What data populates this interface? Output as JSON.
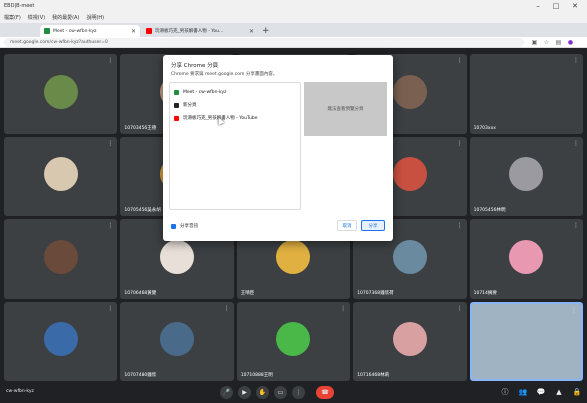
{
  "window": {
    "title": "EBD|B-meet",
    "menu": [
      "檔案(F)",
      "檢視(V)",
      "我的最愛(A)",
      "說明(H)"
    ]
  },
  "browser": {
    "tabs": [
      {
        "label": "Meet - cw-wfbn-kyz",
        "fav_color": "#1e8e3e"
      },
      {
        "label": "玩滑板巧克_男孩解書人物 - You…",
        "fav_color": "#ff0000"
      }
    ],
    "url": "meet.google.com/cw-wfbn-kyz?authuser=0"
  },
  "dialog": {
    "title": "分享 Chrome 分頁",
    "subtitle": "Chrome 要求與 meet.google.com 分享畫面內容。",
    "sources": [
      {
        "label": "Meet - cw-wfbn-kyz",
        "icon_color": "#1e8e3e"
      },
      {
        "label": "新分頁",
        "icon_color": "#202124"
      },
      {
        "label": "玩滑板巧克_男孩解書人物 - YouTube",
        "icon_color": "#ff0000"
      }
    ],
    "preview_text": "無法查看預覽分頁",
    "share_audio_label": "分享音訊",
    "cancel_label": "取消",
    "share_label": "分享"
  },
  "participants": [
    {
      "name": "",
      "color": "#6a8a4a"
    },
    {
      "name": "10703456王德",
      "color": "#c8a088"
    },
    {
      "name": "",
      "color": "#5a7a9a"
    },
    {
      "name": "",
      "color": "#7a6050"
    },
    {
      "name": "10703xxx",
      "color": "#3c4043"
    },
    {
      "name": "",
      "color": "#d8c8b0"
    },
    {
      "name": "10705456吳永胡",
      "color": "#d8a040"
    },
    {
      "name": "",
      "color": "#8a9a6a"
    },
    {
      "name": "10706528揚源",
      "color": "#c85040"
    },
    {
      "name": "10705456林明",
      "color": "#9a9aa0"
    },
    {
      "name": "",
      "color": "#6a4a3a"
    },
    {
      "name": "10706468黃健",
      "color": "#e8e0d8"
    },
    {
      "name": "王晴臣",
      "color": "#e0b040"
    },
    {
      "name": "10707368鐘欣荷",
      "color": "#6a8aa0"
    },
    {
      "name": "10714摘要",
      "color": "#e898b0"
    },
    {
      "name": "",
      "color": "#3a6aa8"
    },
    {
      "name": "10707480鐘欣",
      "color": "#4a6a8a"
    },
    {
      "name": "10710888王明",
      "color": "#4ab848"
    },
    {
      "name": "10716468林莉",
      "color": "#d8a0a0"
    },
    {
      "name": "",
      "color": "#9fb3c2"
    }
  ],
  "bottom": {
    "meeting_code": "cw-wfbn-kyz"
  }
}
